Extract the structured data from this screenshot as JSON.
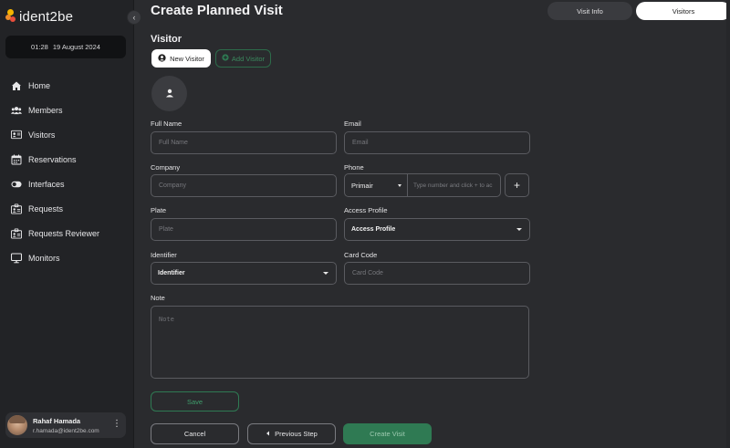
{
  "brand": {
    "name": "ident2be",
    "colors": [
      "#f5b400",
      "#ef8d2a",
      "#e94e3c"
    ]
  },
  "clock": {
    "time": "01:28",
    "date": "19 August 2024"
  },
  "sidebar": {
    "items": [
      {
        "label": "Home",
        "icon": "home-icon"
      },
      {
        "label": "Members",
        "icon": "members-icon"
      },
      {
        "label": "Visitors",
        "icon": "visitors-icon"
      },
      {
        "label": "Reservations",
        "icon": "calendar-icon"
      },
      {
        "label": "Interfaces",
        "icon": "toggle-icon"
      },
      {
        "label": "Requests",
        "icon": "requests-icon"
      },
      {
        "label": "Requests Reviewer",
        "icon": "reviewer-icon"
      },
      {
        "label": "Monitors",
        "icon": "monitor-icon"
      }
    ]
  },
  "user": {
    "name": "Rahaf Hamada",
    "email": "r.hamada@ident2be.com"
  },
  "header": {
    "title": "Create Planned Visit"
  },
  "tabs": [
    {
      "label": "Visit Info",
      "active": false
    },
    {
      "label": "Visitors",
      "active": true
    }
  ],
  "visitor": {
    "section_title": "Visitor",
    "new_visitor_label": "New Visitor",
    "add_visitor_label": "Add Visitor"
  },
  "form": {
    "full_name": {
      "label": "Full Name",
      "placeholder": "Full Name"
    },
    "email": {
      "label": "Email",
      "placeholder": "Email"
    },
    "company": {
      "label": "Company",
      "placeholder": "Company"
    },
    "phone": {
      "label": "Phone",
      "country": "Primair",
      "placeholder": "Type number and click + to ac"
    },
    "plate": {
      "label": "Plate",
      "placeholder": "Plate"
    },
    "access_profile": {
      "label": "Access Profile",
      "value": "Access Profile"
    },
    "identifier": {
      "label": "Identifier",
      "value": "Identifier"
    },
    "card_code": {
      "label": "Card Code",
      "placeholder": "Card Code"
    },
    "note": {
      "label": "Note",
      "placeholder": "Note"
    }
  },
  "actions": {
    "save": "Save",
    "cancel": "Cancel",
    "previous": "Previous Step",
    "create": "Create Visit"
  },
  "colors": {
    "accent_green": "#2f7a53",
    "background": "#2a2b2e",
    "sidebar": "#222326"
  }
}
